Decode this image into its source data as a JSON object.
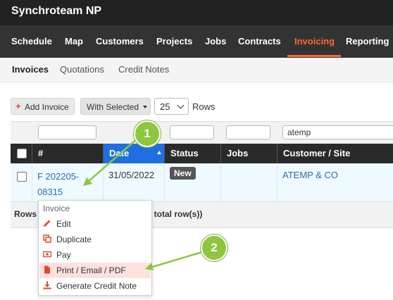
{
  "app": {
    "title": "Synchroteam NP"
  },
  "nav": {
    "items": [
      {
        "label": "Schedule"
      },
      {
        "label": "Map"
      },
      {
        "label": "Customers"
      },
      {
        "label": "Projects"
      },
      {
        "label": "Jobs"
      },
      {
        "label": "Contracts"
      },
      {
        "label": "Invoicing"
      },
      {
        "label": "Reporting"
      }
    ],
    "active": "Invoicing"
  },
  "subnav": {
    "items": [
      {
        "label": "Invoices"
      },
      {
        "label": "Quotations"
      },
      {
        "label": "Credit Notes"
      }
    ],
    "active": "Invoices"
  },
  "toolbar": {
    "add_plus": "+",
    "add_label": "Add Invoice",
    "with_selected_label": "With Selected",
    "rows_value": "25",
    "rows_label": "Rows"
  },
  "filters": {
    "customer_value": "atemp"
  },
  "table": {
    "columns": [
      {
        "label": "#"
      },
      {
        "label": "Date"
      },
      {
        "label": "Status"
      },
      {
        "label": "Jobs"
      },
      {
        "label": "Customer / Site"
      }
    ],
    "rows": [
      {
        "number_line1": "F 202205-",
        "number_line2": "08315",
        "date": "31/05/2022",
        "status": "New",
        "jobs": "",
        "customer": "ATEMP & CO"
      }
    ],
    "footer_left": "Rows",
    "footer_right": "42 total row(s))"
  },
  "context_menu": {
    "header": "Invoice",
    "items": [
      {
        "label": "Edit",
        "icon": "pencil-icon"
      },
      {
        "label": "Duplicate",
        "icon": "duplicate-icon"
      },
      {
        "label": "Pay",
        "icon": "money-icon"
      },
      {
        "label": "Print / Email / PDF",
        "icon": "file-icon"
      },
      {
        "label": "Generate Credit Note",
        "icon": "download-icon"
      }
    ]
  },
  "annotations": [
    {
      "label": "1"
    },
    {
      "label": "2"
    }
  ],
  "colors": {
    "accent": "#ff6633",
    "link": "#2a6db5",
    "sort_header": "#1f6fe0",
    "annotation": "#8dc63f",
    "icon_red": "#e0482b"
  }
}
